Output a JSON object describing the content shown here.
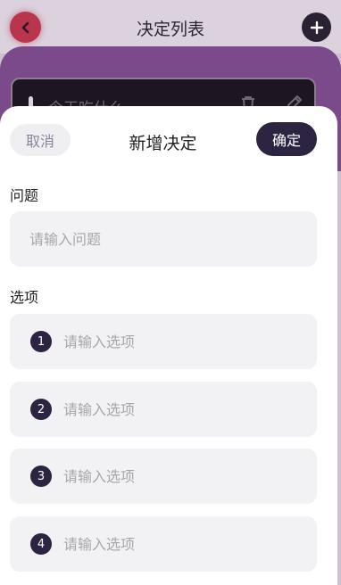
{
  "background_page": {
    "title": "决定列表",
    "decision_item_text": "今天吃什么"
  },
  "sheet": {
    "cancel_label": "取消",
    "title": "新增决定",
    "confirm_label": "确定",
    "question_label": "问题",
    "question_placeholder": "请输入问题",
    "question_value": "",
    "options_label": "选项",
    "options": [
      {
        "number": "1",
        "placeholder": "请输入选项",
        "value": ""
      },
      {
        "number": "2",
        "placeholder": "请输入选项",
        "value": ""
      },
      {
        "number": "3",
        "placeholder": "请输入选项",
        "value": ""
      },
      {
        "number": "4",
        "placeholder": "请输入选项",
        "value": ""
      }
    ]
  },
  "icons": {
    "back": "chevron-left-icon",
    "add": "plus-icon",
    "delete": "trash-icon",
    "edit": "pencil-icon"
  },
  "colors": {
    "accent_dark": "#2c2440",
    "back_button": "#b8354d",
    "header_purple": "#7b4a8a"
  }
}
